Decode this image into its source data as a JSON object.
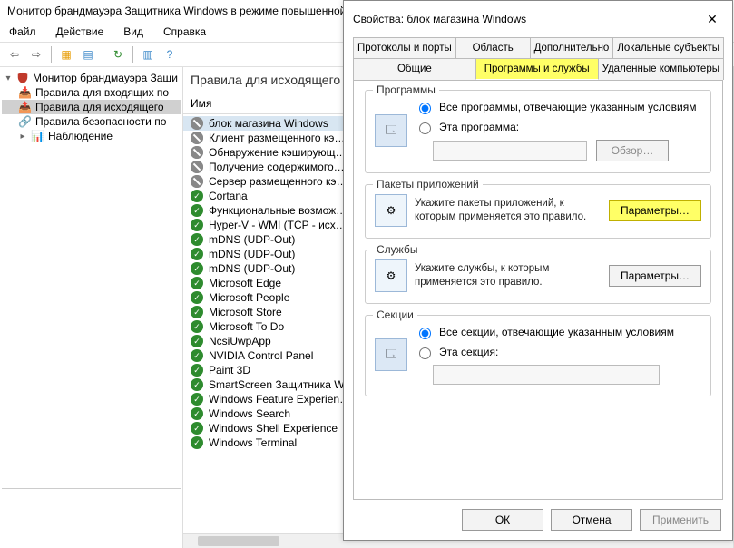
{
  "main": {
    "title": "Монитор брандмауэра Защитника Windows в режиме повышенной безопасности",
    "menu": [
      "Файл",
      "Действие",
      "Вид",
      "Справка"
    ]
  },
  "tree": {
    "root": "Монитор брандмауэра Защи",
    "items": [
      "Правила для входящих по",
      "Правила для исходящего",
      "Правила безопасности по",
      "Наблюдение"
    ],
    "selected_index": 1
  },
  "rules": {
    "panel_title": "Правила для исходящего п",
    "column": "Имя",
    "items": [
      {
        "icon": "block",
        "label": "блок магазина Windows",
        "selected": true
      },
      {
        "icon": "block",
        "label": "Клиент размещенного кэ…"
      },
      {
        "icon": "block",
        "label": "Обнаружение кэширующ…"
      },
      {
        "icon": "block",
        "label": "Получение содержимого…"
      },
      {
        "icon": "block",
        "label": "Сервер размещенного кэ…"
      },
      {
        "icon": "allow",
        "label": "Cortana"
      },
      {
        "icon": "allow",
        "label": "Функциональные возмож…"
      },
      {
        "icon": "allow",
        "label": "Hyper-V - WMI (TCP - исх…"
      },
      {
        "icon": "allow",
        "label": "mDNS (UDP-Out)"
      },
      {
        "icon": "allow",
        "label": "mDNS (UDP-Out)"
      },
      {
        "icon": "allow",
        "label": "mDNS (UDP-Out)"
      },
      {
        "icon": "allow",
        "label": "Microsoft Edge"
      },
      {
        "icon": "allow",
        "label": "Microsoft People"
      },
      {
        "icon": "allow",
        "label": "Microsoft Store"
      },
      {
        "icon": "allow",
        "label": "Microsoft To Do"
      },
      {
        "icon": "allow",
        "label": "NcsiUwpApp"
      },
      {
        "icon": "allow",
        "label": "NVIDIA Control Panel"
      },
      {
        "icon": "allow",
        "label": "Paint 3D"
      },
      {
        "icon": "allow",
        "label": "SmartScreen Защитника W…"
      },
      {
        "icon": "allow",
        "label": "Windows Feature Experien…"
      },
      {
        "icon": "allow",
        "label": "Windows Search"
      },
      {
        "icon": "allow",
        "label": "Windows Shell Experience"
      },
      {
        "icon": "allow",
        "label": "Windows Terminal"
      }
    ]
  },
  "dialog": {
    "title": "Свойства: блок магазина Windows",
    "tabs_row1": [
      "Протоколы и порты",
      "Область",
      "Дополнительно",
      "Локальные субъекты"
    ],
    "tabs_row2": [
      "Общие",
      "Программы и службы",
      "Удаленные компьютеры"
    ],
    "active_tab": "Программы и службы",
    "groups": {
      "programs": {
        "legend": "Программы",
        "radio_all": "Все программы, отвечающие указанным условиям",
        "radio_this": "Эта программа:",
        "browse": "Обзор…"
      },
      "packages": {
        "legend": "Пакеты приложений",
        "desc": "Укажите пакеты приложений, к которым применяется это правило.",
        "btn": "Параметры…"
      },
      "services": {
        "legend": "Службы",
        "desc": "Укажите службы, к которым применяется это правило.",
        "btn": "Параметры…"
      },
      "sections": {
        "legend": "Секции",
        "radio_all": "Все секции, отвечающие указанным условиям",
        "radio_this": "Эта секция:"
      }
    },
    "buttons": {
      "ok": "ОК",
      "cancel": "Отмена",
      "apply": "Применить"
    }
  }
}
